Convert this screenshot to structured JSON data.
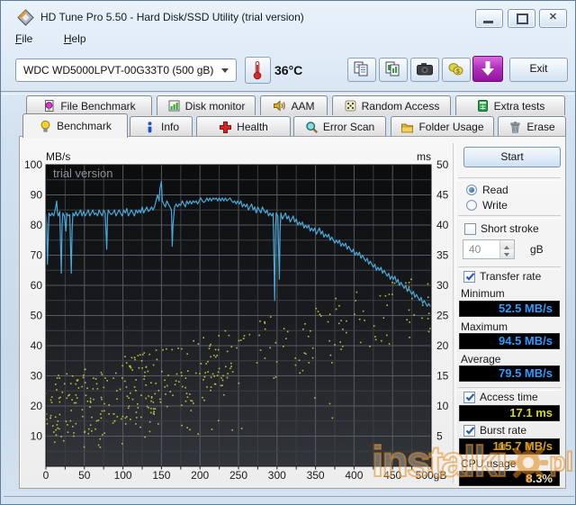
{
  "window": {
    "title": "HD Tune Pro 5.50 - Hard Disk/SSD Utility (trial version)"
  },
  "menu": {
    "file": "File",
    "help": "Help"
  },
  "toolbar": {
    "drive": "WDC WD5000LPVT-00G33T0 (500 gB)",
    "temperature": "36°C",
    "exit": "Exit",
    "icons": [
      "thermometer-icon",
      "copy-text-icon",
      "copy-image-icon",
      "camera-icon",
      "coins-icon",
      "download-icon"
    ]
  },
  "tabs": {
    "row_top": [
      "File Benchmark",
      "Disk monitor",
      "AAM",
      "Random Access",
      "Extra tests"
    ],
    "row_bottom": [
      "Benchmark",
      "Info",
      "Health",
      "Error Scan",
      "Folder Usage",
      "Erase"
    ],
    "active": "Benchmark"
  },
  "controls": {
    "start": "Start",
    "read": "Read",
    "write": "Write",
    "short_stroke": "Short stroke",
    "capacity_value": "40",
    "capacity_unit": "gB",
    "transfer_rate": "Transfer rate",
    "minimum_label": "Minimum",
    "minimum_value": "52.5 MB/s",
    "maximum_label": "Maximum",
    "maximum_value": "94.5 MB/s",
    "average_label": "Average",
    "average_value": "79.5 MB/s",
    "access_time": "Access time",
    "access_time_value": "17.1 ms",
    "burst_rate": "Burst rate",
    "burst_rate_value": "115.7 MB/s",
    "cpu_usage_label": "CPU usage",
    "cpu_usage_value": "8.3%",
    "states": {
      "read": true,
      "write": false,
      "short_stroke": false,
      "transfer_rate": true,
      "access_time": true,
      "burst_rate": true
    }
  },
  "colors": {
    "rate_value": "#2e9bff",
    "access_value": "#d6d61e",
    "burst_value": "#d2a41c",
    "cpu_value": "#eae6c2"
  },
  "watermark": {
    "text": "instalki",
    "suffix": "pl"
  },
  "chart_data": {
    "type": "line+scatter",
    "title": "",
    "x_axis": {
      "min": 0,
      "max": 500,
      "tick_step": 50,
      "grid_step": 25,
      "unit": "gB"
    },
    "y_left": {
      "label": "MB/s",
      "min": 0,
      "max": 100,
      "tick_step": 10,
      "grid_step": 5
    },
    "y_right": {
      "label": "ms",
      "min": 0,
      "max": 50,
      "tick_step": 5
    },
    "trial_watermark": "trial version",
    "grid": true,
    "series": {
      "transfer_rate": {
        "name": "Transfer rate",
        "color": "#4aa8d8",
        "axis": "left",
        "points": [
          [
            0,
            84
          ],
          [
            1,
            80
          ],
          [
            2,
            67
          ],
          [
            3,
            76
          ],
          [
            4,
            84
          ],
          [
            6,
            83
          ],
          [
            8,
            84
          ],
          [
            10,
            83
          ],
          [
            12,
            85
          ],
          [
            14,
            88
          ],
          [
            15,
            84
          ],
          [
            16,
            83
          ],
          [
            18,
            84.5
          ],
          [
            20,
            64
          ],
          [
            21,
            80
          ],
          [
            22,
            84
          ],
          [
            24,
            83
          ],
          [
            26,
            78
          ],
          [
            27,
            84
          ],
          [
            29,
            83
          ],
          [
            31,
            83.5
          ],
          [
            33,
            64
          ],
          [
            34,
            78
          ],
          [
            35,
            84
          ],
          [
            37,
            83
          ],
          [
            39,
            84.5
          ],
          [
            41,
            83
          ],
          [
            43,
            84
          ],
          [
            45,
            85
          ],
          [
            47,
            83
          ],
          [
            49,
            84.5
          ],
          [
            51,
            83
          ],
          [
            53,
            84
          ],
          [
            55,
            85
          ],
          [
            57,
            83
          ],
          [
            59,
            84
          ],
          [
            61,
            85
          ],
          [
            63,
            83.5
          ],
          [
            65,
            84
          ],
          [
            67,
            83
          ],
          [
            69,
            85
          ],
          [
            71,
            84
          ],
          [
            73,
            83
          ],
          [
            75,
            85
          ],
          [
            77,
            84
          ],
          [
            79,
            72
          ],
          [
            80,
            83
          ],
          [
            81,
            85
          ],
          [
            83,
            84
          ],
          [
            85,
            83.5
          ],
          [
            87,
            84
          ],
          [
            89,
            85
          ],
          [
            91,
            83
          ],
          [
            93,
            84
          ],
          [
            95,
            85
          ],
          [
            97,
            84
          ],
          [
            99,
            83
          ],
          [
            101,
            85
          ],
          [
            103,
            84
          ],
          [
            105,
            85.5
          ],
          [
            107,
            83
          ],
          [
            109,
            84
          ],
          [
            111,
            85
          ],
          [
            113,
            84
          ],
          [
            115,
            83
          ],
          [
            117,
            85
          ],
          [
            119,
            84
          ],
          [
            121,
            85
          ],
          [
            123,
            84
          ],
          [
            125,
            86
          ],
          [
            127,
            84
          ],
          [
            129,
            85
          ],
          [
            131,
            86
          ],
          [
            133,
            84.5
          ],
          [
            135,
            85
          ],
          [
            137,
            86
          ],
          [
            139,
            85
          ],
          [
            141,
            86
          ],
          [
            143,
            88
          ],
          [
            145,
            90
          ],
          [
            147,
            88
          ],
          [
            148,
            92
          ],
          [
            150,
            94.5
          ],
          [
            151,
            88
          ],
          [
            153,
            87
          ],
          [
            155,
            86
          ],
          [
            157,
            88
          ],
          [
            159,
            87
          ],
          [
            161,
            86
          ],
          [
            163,
            85
          ],
          [
            164,
            73
          ],
          [
            165,
            80
          ],
          [
            167,
            86
          ],
          [
            169,
            87
          ],
          [
            171,
            86
          ],
          [
            173,
            87
          ],
          [
            175,
            86.5
          ],
          [
            177,
            88
          ],
          [
            179,
            87
          ],
          [
            181,
            86
          ],
          [
            183,
            88
          ],
          [
            185,
            87
          ],
          [
            187,
            88
          ],
          [
            189,
            87
          ],
          [
            191,
            88
          ],
          [
            193,
            87.5
          ],
          [
            195,
            88
          ],
          [
            197,
            87
          ],
          [
            199,
            88
          ],
          [
            201,
            89
          ],
          [
            203,
            88
          ],
          [
            205,
            87.5
          ],
          [
            207,
            88
          ],
          [
            209,
            89
          ],
          [
            211,
            88
          ],
          [
            213,
            89
          ],
          [
            215,
            88
          ],
          [
            217,
            89
          ],
          [
            219,
            88.5
          ],
          [
            221,
            89
          ],
          [
            223,
            88
          ],
          [
            225,
            89
          ],
          [
            227,
            88
          ],
          [
            229,
            89
          ],
          [
            231,
            88
          ],
          [
            233,
            89
          ],
          [
            235,
            88
          ],
          [
            237,
            88.5
          ],
          [
            239,
            89
          ],
          [
            241,
            88
          ],
          [
            243,
            87.5
          ],
          [
            245,
            88
          ],
          [
            247,
            87
          ],
          [
            249,
            88
          ],
          [
            251,
            87
          ],
          [
            253,
            88
          ],
          [
            255,
            86
          ],
          [
            257,
            87
          ],
          [
            259,
            86
          ],
          [
            261,
            87
          ],
          [
            263,
            85
          ],
          [
            265,
            86
          ],
          [
            267,
            87
          ],
          [
            269,
            85
          ],
          [
            271,
            86
          ],
          [
            273,
            84
          ],
          [
            275,
            86
          ],
          [
            277,
            85
          ],
          [
            279,
            84
          ],
          [
            281,
            86
          ],
          [
            283,
            85
          ],
          [
            285,
            84
          ],
          [
            287,
            85
          ],
          [
            289,
            83
          ],
          [
            291,
            84
          ],
          [
            293,
            83
          ],
          [
            295,
            84
          ],
          [
            297,
            55
          ],
          [
            298,
            78
          ],
          [
            299,
            84
          ],
          [
            301,
            83
          ],
          [
            303,
            62
          ],
          [
            304,
            78
          ],
          [
            305,
            84
          ],
          [
            307,
            82
          ],
          [
            309,
            83
          ],
          [
            311,
            84
          ],
          [
            313,
            82
          ],
          [
            315,
            83
          ],
          [
            317,
            81
          ],
          [
            319,
            82
          ],
          [
            321,
            83
          ],
          [
            323,
            81
          ],
          [
            325,
            82
          ],
          [
            327,
            80
          ],
          [
            329,
            81
          ],
          [
            331,
            80
          ],
          [
            333,
            81
          ],
          [
            335,
            79
          ],
          [
            337,
            80
          ],
          [
            339,
            79
          ],
          [
            341,
            80
          ],
          [
            343,
            78
          ],
          [
            345,
            79
          ],
          [
            347,
            78
          ],
          [
            349,
            79
          ],
          [
            351,
            77
          ],
          [
            353,
            78
          ],
          [
            355,
            79
          ],
          [
            357,
            77
          ],
          [
            359,
            78
          ],
          [
            361,
            76
          ],
          [
            363,
            77
          ],
          [
            365,
            76
          ],
          [
            367,
            77
          ],
          [
            369,
            75
          ],
          [
            371,
            76
          ],
          [
            373,
            75
          ],
          [
            375,
            74
          ],
          [
            377,
            75
          ],
          [
            379,
            74
          ],
          [
            381,
            75
          ],
          [
            383,
            73
          ],
          [
            385,
            74
          ],
          [
            387,
            73
          ],
          [
            389,
            74
          ],
          [
            391,
            72
          ],
          [
            393,
            73
          ],
          [
            395,
            72
          ],
          [
            397,
            71
          ],
          [
            399,
            72
          ],
          [
            401,
            70
          ],
          [
            403,
            71
          ],
          [
            405,
            70
          ],
          [
            407,
            71
          ],
          [
            409,
            69
          ],
          [
            411,
            70
          ],
          [
            413,
            69
          ],
          [
            415,
            68
          ],
          [
            417,
            69
          ],
          [
            419,
            67
          ],
          [
            421,
            68
          ],
          [
            423,
            67
          ],
          [
            425,
            66
          ],
          [
            427,
            67
          ],
          [
            429,
            65
          ],
          [
            431,
            66
          ],
          [
            433,
            65
          ],
          [
            435,
            66
          ],
          [
            437,
            64
          ],
          [
            439,
            65
          ],
          [
            441,
            64
          ],
          [
            443,
            63
          ],
          [
            445,
            64
          ],
          [
            447,
            62
          ],
          [
            449,
            63
          ],
          [
            451,
            62
          ],
          [
            453,
            63
          ],
          [
            455,
            61
          ],
          [
            457,
            62
          ],
          [
            459,
            60
          ],
          [
            461,
            61
          ],
          [
            463,
            60
          ],
          [
            465,
            59
          ],
          [
            467,
            60
          ],
          [
            469,
            58
          ],
          [
            471,
            59
          ],
          [
            473,
            58
          ],
          [
            475,
            57
          ],
          [
            477,
            58
          ],
          [
            479,
            56
          ],
          [
            481,
            57
          ],
          [
            483,
            56
          ],
          [
            485,
            55
          ],
          [
            487,
            56
          ],
          [
            489,
            54
          ],
          [
            491,
            55
          ],
          [
            493,
            54
          ],
          [
            495,
            53
          ],
          [
            497,
            54
          ],
          [
            499,
            53
          ]
        ]
      },
      "access_time": {
        "name": "Access time",
        "color": "#c6c63c",
        "axis": "right",
        "style": "scatter",
        "seed": 20,
        "count": 400,
        "ms_base": 9,
        "ms_slope": 18,
        "ms_jitter": 5.5,
        "left_density": 0.75,
        "low_outlier_rate": 0.07,
        "ms_clamp": [
          2,
          31
        ]
      }
    }
  }
}
